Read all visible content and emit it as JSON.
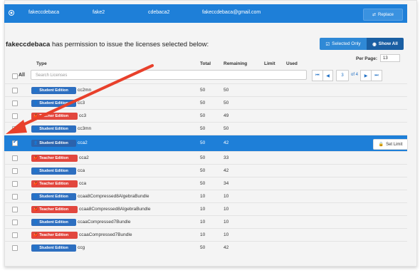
{
  "user_row": {
    "col1": "fakeccdebaca",
    "col2": "fake2",
    "col3": "cdebaca2",
    "col4": "fakeccdebaca@gmail.com",
    "replace_label": "Replace",
    "replace_icon": "⇄"
  },
  "heading": {
    "user": "fakeccdebaca",
    "text": " has permission to issue the licenses selected below:"
  },
  "filter": {
    "selected_only_label": "Selected Only",
    "show_all_label": "Show All"
  },
  "per_page": {
    "label": "Per Page:",
    "value": "13"
  },
  "columns": {
    "type": "Type",
    "total": "Total",
    "remaining": "Remaining",
    "limit": "Limit",
    "used": "Used"
  },
  "search": {
    "all_label": "All",
    "placeholder": "Search Licenses"
  },
  "pager": {
    "first": "⏮",
    "prev": "◀",
    "page": "3",
    "of": "of 4",
    "next": "▶",
    "last": "⏭"
  },
  "badges": {
    "student": "Student Edition",
    "teacher": "Teacher Edition"
  },
  "rows": [
    {
      "edition": "student",
      "name": "cc2mn",
      "total": "50",
      "remaining": "50",
      "checked": false
    },
    {
      "edition": "student",
      "name": "cc3",
      "total": "50",
      "remaining": "50",
      "checked": false
    },
    {
      "edition": "teacher",
      "name": "cc3",
      "total": "50",
      "remaining": "49",
      "checked": false
    },
    {
      "edition": "student",
      "name": "cc3mn",
      "total": "50",
      "remaining": "50",
      "checked": false
    },
    {
      "edition": "student",
      "name": "cca2",
      "total": "50",
      "remaining": "42",
      "checked": true
    },
    {
      "edition": "teacher",
      "name": "cca2",
      "total": "50",
      "remaining": "33",
      "checked": false
    },
    {
      "edition": "student",
      "name": "cca",
      "total": "50",
      "remaining": "42",
      "checked": false
    },
    {
      "edition": "teacher",
      "name": "cca",
      "total": "50",
      "remaining": "34",
      "checked": false
    },
    {
      "edition": "student",
      "name": "ccaa8Compressed8AlgebraBundle",
      "total": "10",
      "remaining": "10",
      "checked": false
    },
    {
      "edition": "teacher",
      "name": "ccaa8Compressed8AlgebraBundle",
      "total": "10",
      "remaining": "10",
      "checked": false
    },
    {
      "edition": "student",
      "name": "ccaaCompressed7Bundle",
      "total": "10",
      "remaining": "10",
      "checked": false
    },
    {
      "edition": "teacher",
      "name": "ccaaCompressed7Bundle",
      "total": "10",
      "remaining": "10",
      "checked": false
    },
    {
      "edition": "student",
      "name": "ccg",
      "total": "50",
      "remaining": "42",
      "checked": false
    }
  ],
  "set_limit_label": "Set Limit",
  "colors": {
    "accent": "#1e7fd8",
    "student": "#2d6fc0",
    "teacher": "#e2473e",
    "arrow": "#e8402b"
  }
}
